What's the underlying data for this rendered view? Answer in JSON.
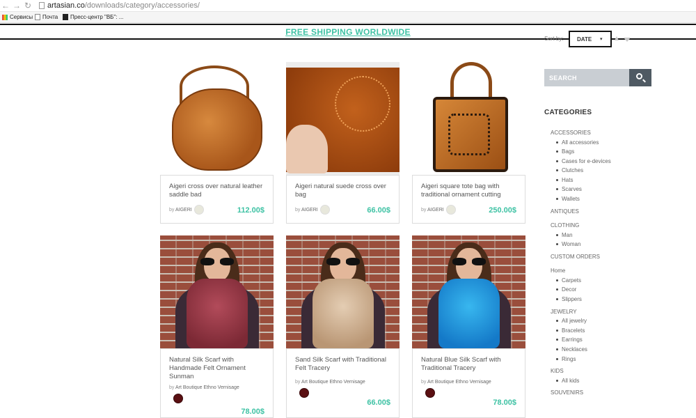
{
  "browser": {
    "url_host": "artasian.co",
    "url_path": "/downloads/category/accessories/",
    "bookmarks": [
      "Сервисы",
      "Почта",
      "Пресс-центр \"ВБ\": ..."
    ]
  },
  "header": {
    "shipping_banner": "FREE SHIPPING WORLDWIDE"
  },
  "sort": {
    "label": "Sort by:",
    "selected": "DATE"
  },
  "search": {
    "placeholder": "SEARCH"
  },
  "sidebar": {
    "categories_title": "CATEGORIES",
    "groups": [
      {
        "label": "ACCESSORIES",
        "items": [
          "All accessories",
          "Bags",
          "Cases for e-devices",
          "Clutches",
          "Hats",
          "Scarves",
          "Wallets"
        ]
      },
      {
        "label": "ANTIQUES",
        "items": []
      },
      {
        "label": "CLOTHING",
        "items": [
          "Man",
          "Woman"
        ]
      },
      {
        "label": "CUSTOM ORDERS",
        "items": []
      },
      {
        "label": "Home",
        "items": [
          "Carpets",
          "Decor",
          "Slippers"
        ]
      },
      {
        "label": "JEWELRY",
        "items": [
          "All jewelry",
          "Bracelets",
          "Earrings",
          "Necklaces",
          "Rings"
        ]
      },
      {
        "label": "KIDS",
        "items": [
          "All kids"
        ]
      },
      {
        "label": "SOUVENIRS",
        "items": []
      }
    ]
  },
  "products": [
    {
      "title": "Aigeri cross over natural leather saddle bad",
      "by": "by",
      "author": "AIGERI",
      "price": "112.00$",
      "image": "leather-saddle-bag"
    },
    {
      "title": "Aigeri natural suede cross over bag",
      "by": "by",
      "author": "AIGERI",
      "price": "66.00$",
      "image": "suede-bag"
    },
    {
      "title": "Aigeri square tote bag with traditional ornament cutting",
      "by": "by",
      "author": "AIGERI",
      "price": "250.00$",
      "image": "square-tote-bag"
    },
    {
      "title": "Natural Silk Scarf with Handmade Felt Ornament Sunman",
      "by": "by",
      "author": "Art Boutique Ethno Vernisage",
      "price": "78.00$",
      "image": "red-scarf"
    },
    {
      "title": "Sand Silk Scarf with Traditional Felt Tracery",
      "by": "by",
      "author": "Art Boutique Ethno Vernisage",
      "price": "66.00$",
      "image": "sand-scarf"
    },
    {
      "title": "Natural Blue Silk Scarf with Traditional Tracery",
      "by": "by",
      "author": "Art Boutique Ethno Vernisage",
      "price": "78.00$",
      "image": "blue-scarf"
    }
  ],
  "colors": {
    "accent": "#3ec2a4",
    "search_bg": "#c9ced3",
    "search_btn": "#4f5a63"
  }
}
